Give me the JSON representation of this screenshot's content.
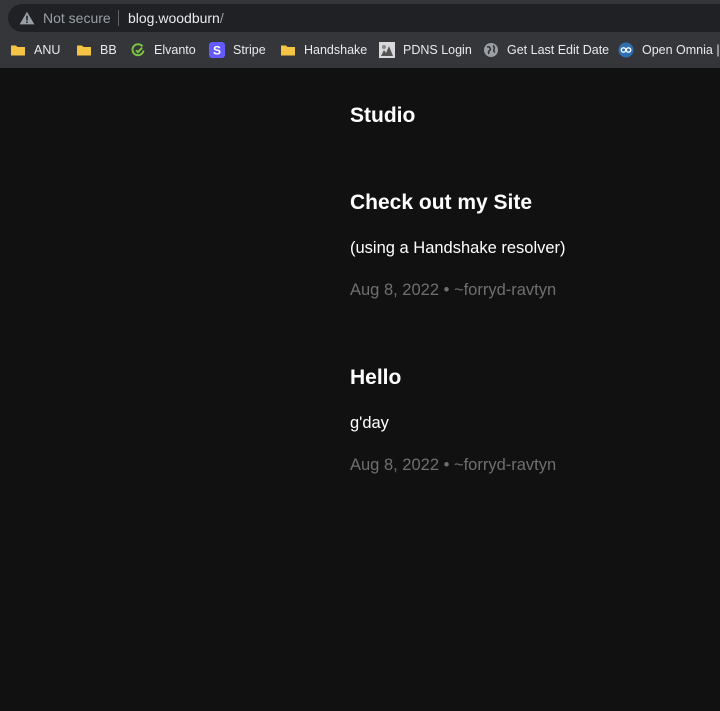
{
  "browser": {
    "security_label": "Not secure",
    "url_host": "blog.woodburn",
    "url_path": "/",
    "warning_icon": "warning-triangle-icon"
  },
  "bookmarks": [
    {
      "label": "ANU",
      "icon": "folder-icon"
    },
    {
      "label": "BB",
      "icon": "folder-icon"
    },
    {
      "label": "Elvanto",
      "icon": "elvanto-icon"
    },
    {
      "label": "Stripe",
      "icon": "stripe-icon"
    },
    {
      "label": "Handshake",
      "icon": "folder-icon"
    },
    {
      "label": "PDNS Login",
      "icon": "pdns-icon"
    },
    {
      "label": "Get Last Edit Date",
      "icon": "globe-icon"
    },
    {
      "label": "Open Omnia | S",
      "icon": "omnia-icon"
    }
  ],
  "blog": {
    "site_title": "Studio",
    "posts": [
      {
        "title": "Check out my Site",
        "body": "(using a Handshake resolver)",
        "meta": "Aug 8, 2022 • ~forryd-ravtyn"
      },
      {
        "title": "Hello",
        "body": "g'day",
        "meta": "Aug 8, 2022 • ~forryd-ravtyn"
      }
    ]
  },
  "colors": {
    "page_background": "#111111",
    "chrome_background": "#35363a",
    "address_background": "#202124",
    "folder": "#f6c445",
    "stripe": "#635bff",
    "elvanto": "#7cc242",
    "meta_text": "#6f6f6f"
  }
}
